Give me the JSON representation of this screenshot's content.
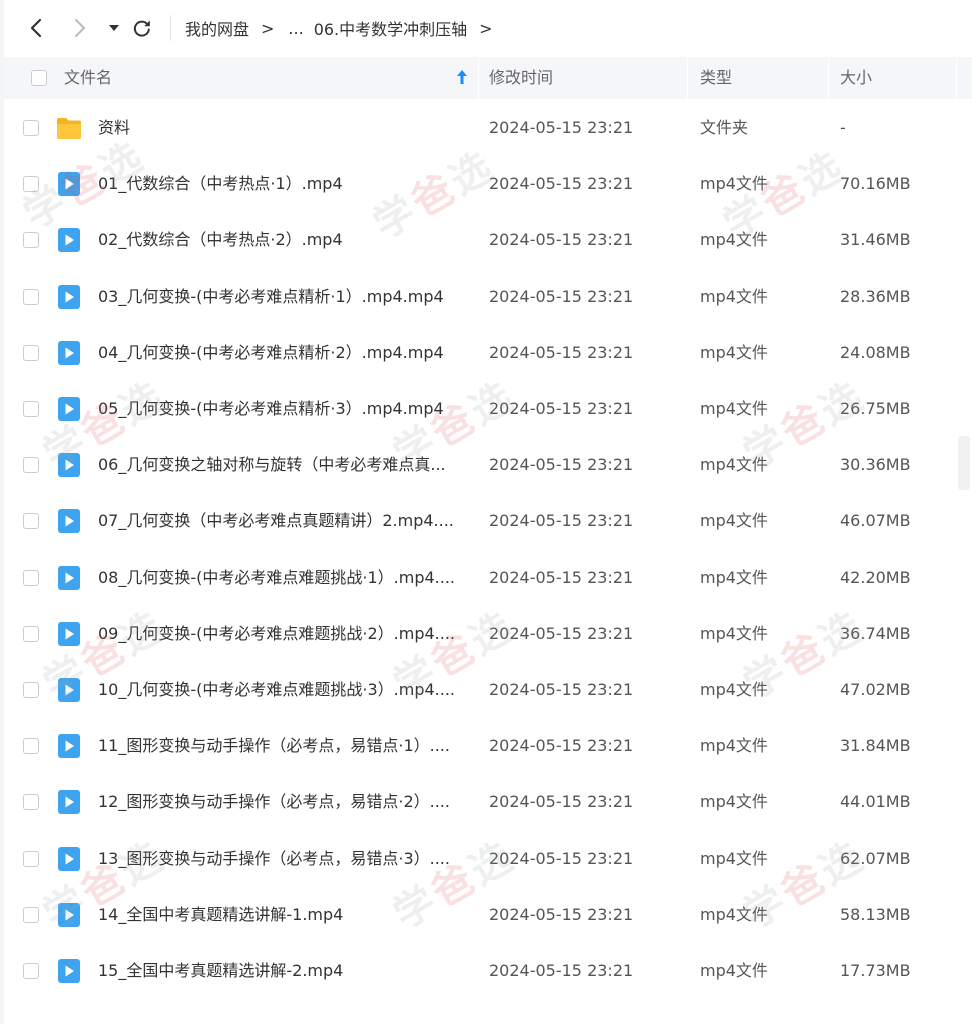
{
  "nav": {
    "breadcrumb_root": "我的网盘",
    "breadcrumb_ellipsis": "...",
    "breadcrumb_current": "06.中考数学冲刺压轴",
    "separator": ">"
  },
  "columns": {
    "name": "文件名",
    "modified": "修改时间",
    "type": "类型",
    "size": "大小"
  },
  "files": [
    {
      "name": "资料",
      "modified": "2024-05-15 23:21",
      "type": "文件夹",
      "size": "-",
      "icon": "folder-icon"
    },
    {
      "name": "01_代数综合（中考热点·1）.mp4",
      "modified": "2024-05-15 23:21",
      "type": "mp4文件",
      "size": "70.16MB",
      "icon": "video-file-icon"
    },
    {
      "name": "02_代数综合（中考热点·2）.mp4",
      "modified": "2024-05-15 23:21",
      "type": "mp4文件",
      "size": "31.46MB",
      "icon": "video-file-icon"
    },
    {
      "name": "03_几何变换-(中考必考难点精析·1）.mp4.mp4",
      "modified": "2024-05-15 23:21",
      "type": "mp4文件",
      "size": "28.36MB",
      "icon": "video-file-icon"
    },
    {
      "name": "04_几何变换-(中考必考难点精析·2）.mp4.mp4",
      "modified": "2024-05-15 23:21",
      "type": "mp4文件",
      "size": "24.08MB",
      "icon": "video-file-icon"
    },
    {
      "name": "05_几何变换-(中考必考难点精析·3）.mp4.mp4",
      "modified": "2024-05-15 23:21",
      "type": "mp4文件",
      "size": "26.75MB",
      "icon": "video-file-icon"
    },
    {
      "name": "06_几何变换之轴对称与旋转（中考必考难点真...",
      "modified": "2024-05-15 23:21",
      "type": "mp4文件",
      "size": "30.36MB",
      "icon": "video-file-icon"
    },
    {
      "name": "07_几何变换（中考必考难点真题精讲）2.mp4....",
      "modified": "2024-05-15 23:21",
      "type": "mp4文件",
      "size": "46.07MB",
      "icon": "video-file-icon"
    },
    {
      "name": "08_几何变换-(中考必考难点难题挑战·1）.mp4....",
      "modified": "2024-05-15 23:21",
      "type": "mp4文件",
      "size": "42.20MB",
      "icon": "video-file-icon"
    },
    {
      "name": "09_几何变换-(中考必考难点难题挑战·2）.mp4....",
      "modified": "2024-05-15 23:21",
      "type": "mp4文件",
      "size": "36.74MB",
      "icon": "video-file-icon"
    },
    {
      "name": "10_几何变换-(中考必考难点难题挑战·3）.mp4....",
      "modified": "2024-05-15 23:21",
      "type": "mp4文件",
      "size": "47.02MB",
      "icon": "video-file-icon"
    },
    {
      "name": "11_图形变换与动手操作（必考点，易错点·1）....",
      "modified": "2024-05-15 23:21",
      "type": "mp4文件",
      "size": "31.84MB",
      "icon": "video-file-icon"
    },
    {
      "name": "12_图形变换与动手操作（必考点，易错点·2）....",
      "modified": "2024-05-15 23:21",
      "type": "mp4文件",
      "size": "44.01MB",
      "icon": "video-file-icon"
    },
    {
      "name": "13_图形变换与动手操作（必考点，易错点·3）....",
      "modified": "2024-05-15 23:21",
      "type": "mp4文件",
      "size": "62.07MB",
      "icon": "video-file-icon"
    },
    {
      "name": "14_全国中考真题精选讲解-1.mp4",
      "modified": "2024-05-15 23:21",
      "type": "mp4文件",
      "size": "58.13MB",
      "icon": "video-file-icon"
    },
    {
      "name": "15_全国中考真题精选讲解-2.mp4",
      "modified": "2024-05-15 23:21",
      "type": "mp4文件",
      "size": "17.73MB",
      "icon": "video-file-icon"
    }
  ],
  "watermark": {
    "char1": "学",
    "char2": "爸",
    "char3": "选"
  },
  "colors": {
    "accent": "#1a8cff",
    "folder": "#ffc53d",
    "video": "#3fa4f0"
  }
}
